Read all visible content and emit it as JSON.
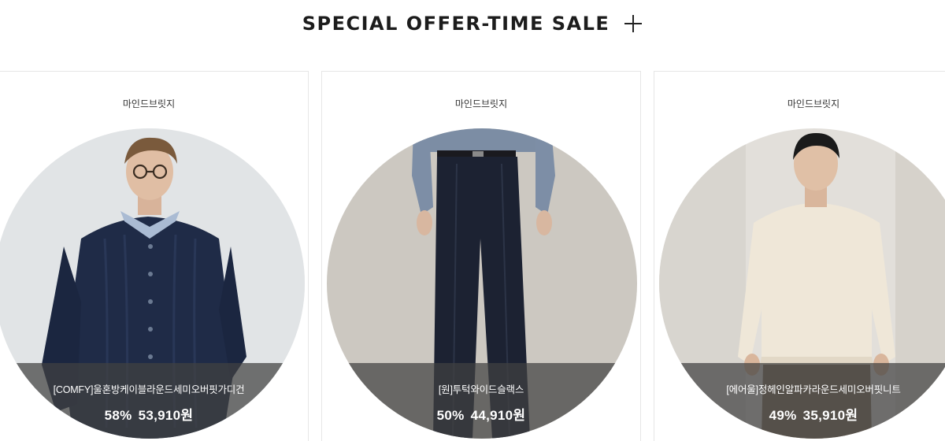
{
  "section": {
    "title": "SPECIAL OFFER-TIME SALE",
    "more_icon": "plus-icon"
  },
  "products": [
    {
      "brand": "마인드브릿지",
      "name": "[COMFY]울혼방케이블라운드세미오버핏가디건",
      "discount": "58%",
      "price": "53,910원",
      "bg_color": "#dcdfe0",
      "garment_color": "#1e2a45"
    },
    {
      "brand": "마인드브릿지",
      "name": "[원]투턱와이드슬랙스",
      "discount": "50%",
      "price": "44,910원",
      "bg_color": "#cbc7c0",
      "garment_color": "#1c2130"
    },
    {
      "brand": "마인드브릿지",
      "name": "[에어울]정헤인알파카라운드세미오버핏니트",
      "discount": "49%",
      "price": "35,910원",
      "bg_color": "#e7e4df",
      "garment_color": "#efe7d8"
    }
  ]
}
